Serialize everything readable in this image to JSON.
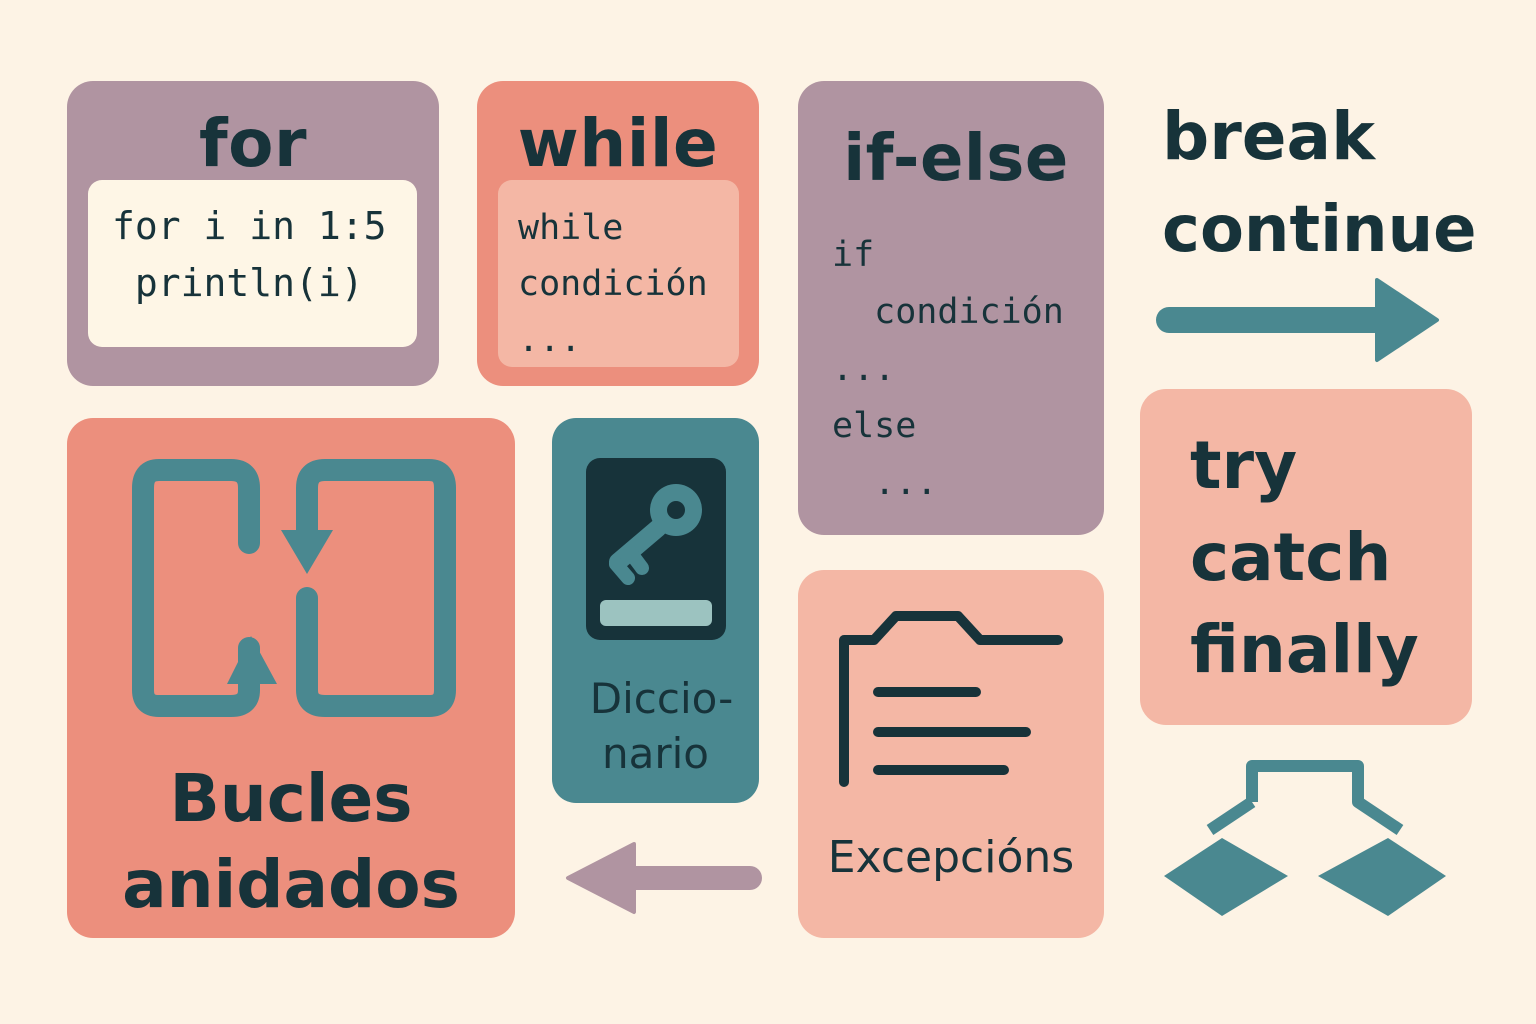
{
  "colors": {
    "background": "#fdf3e5",
    "mauve": "#b094a1",
    "salmon": "#ec8f7d",
    "peach": "#f4b7a5",
    "teal": "#4a8890",
    "dark": "#17333a",
    "cream": "#fef6e6"
  },
  "for_card": {
    "title": "for",
    "code": [
      "for i in 1:5",
      " println(i)"
    ]
  },
  "while_card": {
    "title": "while",
    "code": [
      "while",
      "condición",
      "..."
    ]
  },
  "ifelse_card": {
    "title": "if-else",
    "code": [
      "if",
      "  condición",
      "...",
      "else",
      "  ..."
    ]
  },
  "break_continue": {
    "break": "break",
    "continue": "continue",
    "arrow_icon": "arrow-right-icon"
  },
  "try_card": {
    "try": "try",
    "catch": "catch",
    "finally": "finally"
  },
  "nested_card": {
    "line1": "Bucles",
    "line2": "anidados",
    "icon": "nested-loop-icon"
  },
  "dict_card": {
    "line1": "Diccio-",
    "line2": "nario",
    "icon": "book-key-icon"
  },
  "exc_card": {
    "label": "Excepcións",
    "icon": "document-icon"
  },
  "left_arrow": {
    "icon": "arrow-left-icon"
  },
  "branch": {
    "icon": "branch-diamond-icon"
  }
}
